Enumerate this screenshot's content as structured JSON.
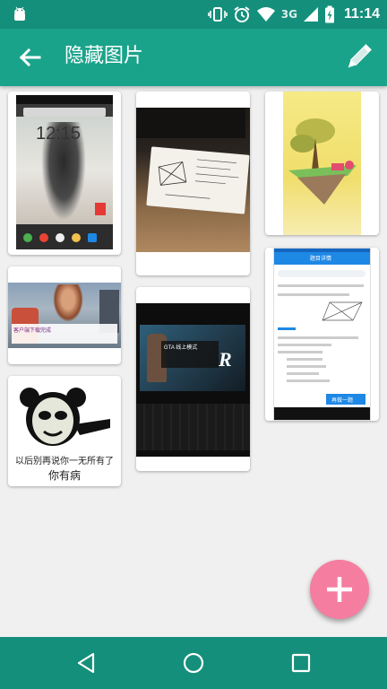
{
  "status_bar": {
    "network": "3G",
    "time": "11:14",
    "icons": [
      "android-icon",
      "vibrate-icon",
      "alarm-icon",
      "wifi-icon",
      "signal-icon",
      "battery-icon"
    ]
  },
  "app_bar": {
    "title": "隐藏图片",
    "back_icon": "arrow-back-icon",
    "edit_icon": "pencil-icon"
  },
  "photos": {
    "lockscreen": {
      "clock": "12:15"
    },
    "game_screenshot": {
      "caption": "客户端下载完成"
    },
    "meme": {
      "line1": "以后别再说你一无所有了",
      "line2": "你有病"
    },
    "gta": {
      "title": "GTA 线上模式"
    },
    "quiz": {
      "header": "题目详情",
      "button": "再做一题"
    }
  },
  "colors": {
    "status_bar": "#148f7b",
    "app_bar": "#1aa38b",
    "fab": "#f57da0",
    "background": "#f0f0f0"
  },
  "fab": {
    "icon": "add-icon"
  },
  "nav_bar": {
    "icons": [
      "back-triangle-icon",
      "home-circle-icon",
      "recents-square-icon"
    ]
  }
}
